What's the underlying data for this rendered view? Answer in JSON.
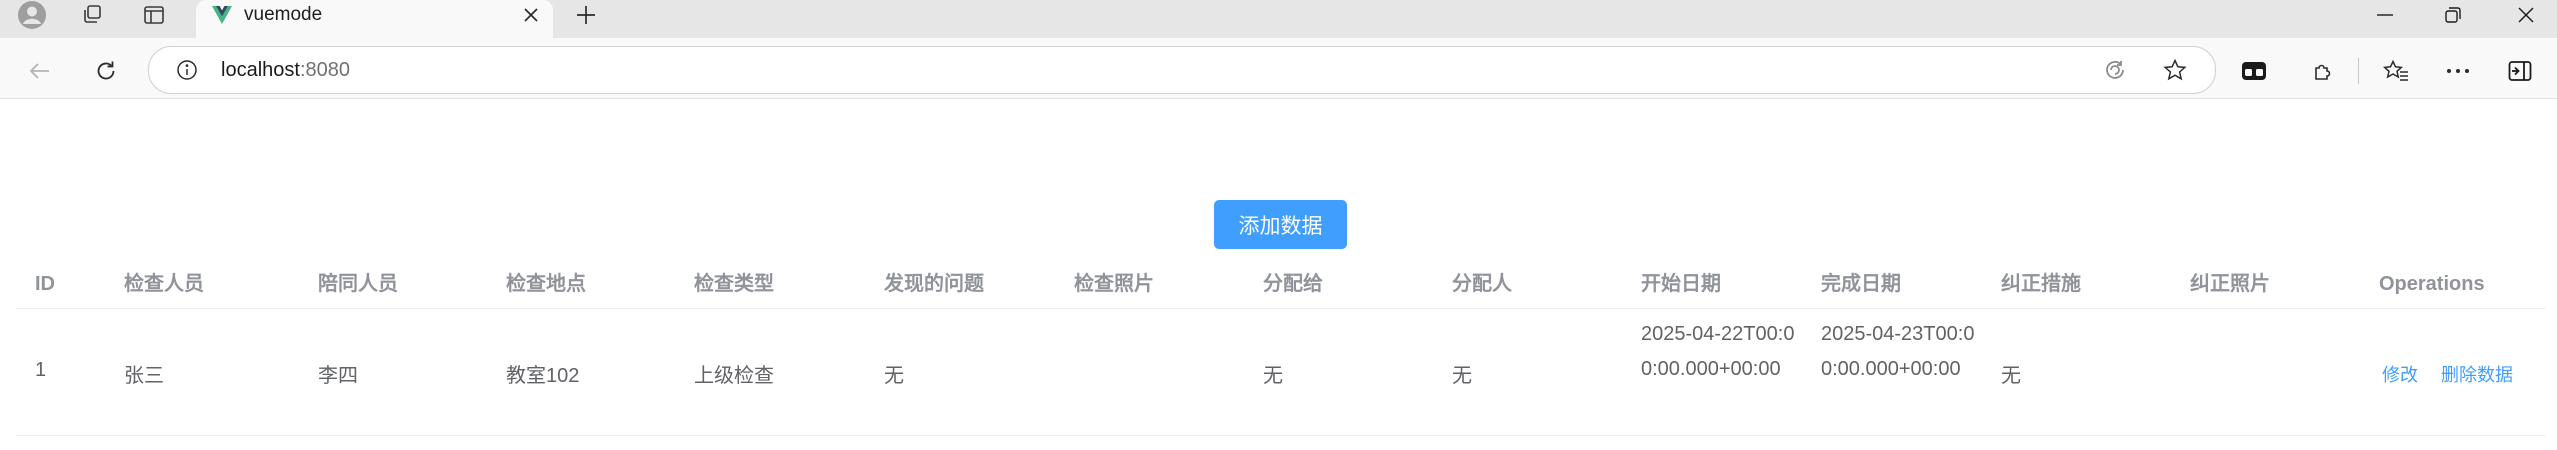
{
  "browser": {
    "tab_title": "vuemode",
    "url_host": "localhost",
    "url_port": ":8080",
    "icons": [
      "profile-icon",
      "workspaces-icon",
      "tab-actions-icon",
      "vue-favicon",
      "close-icon",
      "new-tab-icon",
      "minimize-icon",
      "restore-icon",
      "close-window-icon",
      "back-icon",
      "refresh-icon",
      "site-info-icon",
      "read-aloud-icon",
      "favorite-star-icon",
      "split-screen-icon",
      "extensions-icon",
      "favorites-icon",
      "more-icon",
      "sidebar-icon"
    ],
    "accent": "#409eff"
  },
  "page": {
    "add_button": "添加数据",
    "columns": [
      "ID",
      "检查人员",
      "陪同人员",
      "检查地点",
      "检查类型",
      "发现的问题",
      "检查照片",
      "分配给",
      "分配人",
      "开始日期",
      "完成日期",
      "纠正措施",
      "纠正照片",
      "Operations"
    ],
    "rows": [
      {
        "id": "1",
        "inspector": "张三",
        "companion": "李四",
        "location": "教室102",
        "type": "上级检查",
        "issue": "无",
        "photo": "",
        "assigned_to": "无",
        "assigner": "无",
        "start_date": "2025-04-22T00:00:00.000+00:00",
        "finish_date": "2025-04-23T00:00:00.000+00:00",
        "correction": "无",
        "correction_photo": "",
        "edit_label": "修改",
        "delete_label": "删除数据"
      }
    ]
  }
}
